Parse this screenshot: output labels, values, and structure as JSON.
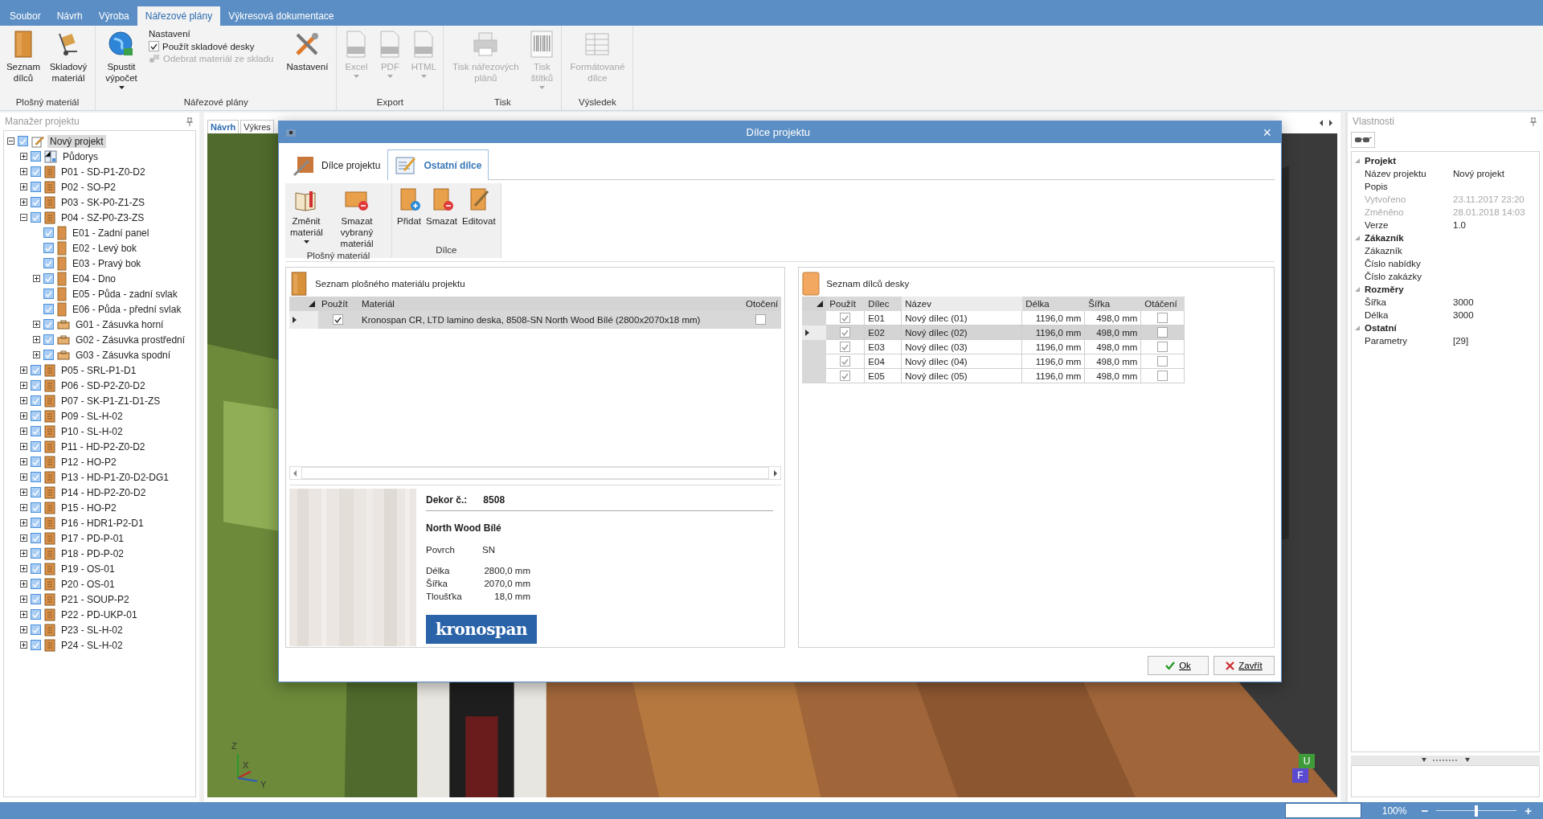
{
  "menu_tabs": [
    {
      "label": "Soubor",
      "selected": false
    },
    {
      "label": "Návrh",
      "selected": false
    },
    {
      "label": "Výroba",
      "selected": false
    },
    {
      "label": "Nářezové plány",
      "selected": true
    },
    {
      "label": "Výkresová dokumentace",
      "selected": false
    }
  ],
  "ribbon": {
    "groups": [
      {
        "label": "Plošný materiál",
        "items": [
          {
            "kind": "large",
            "label": "Seznam dílců",
            "disabled": false,
            "dropdown": false
          },
          {
            "kind": "large",
            "label": "Skladový materiál",
            "disabled": false,
            "dropdown": false
          }
        ]
      },
      {
        "label": "Nářezové plány",
        "items": [
          {
            "kind": "large",
            "label": "Spustit výpočet",
            "disabled": false,
            "dropdown": true
          },
          {
            "kind": "options",
            "title": "Nastavení",
            "checkbox": {
              "label": "Použít skladové desky",
              "checked": true
            },
            "action": {
              "label": "Odebrat materiál ze skladu",
              "disabled": true
            }
          },
          {
            "kind": "large",
            "label": "Nastavení",
            "disabled": false,
            "dropdown": false
          }
        ]
      },
      {
        "label": "Export",
        "items": [
          {
            "kind": "large",
            "label": "Excel",
            "disabled": true,
            "dropdown": true
          },
          {
            "kind": "large",
            "label": "PDF",
            "disabled": true,
            "dropdown": true
          },
          {
            "kind": "large",
            "label": "HTML",
            "disabled": true,
            "dropdown": true
          }
        ]
      },
      {
        "label": "Tisk",
        "items": [
          {
            "kind": "large",
            "label": "Tisk nářezových plánů",
            "disabled": true,
            "dropdown": false
          },
          {
            "kind": "large",
            "label": "Tisk štítků",
            "disabled": true,
            "dropdown": true
          }
        ]
      },
      {
        "label": "Výsledek",
        "items": [
          {
            "kind": "large",
            "label": "Formátované dílce",
            "disabled": true,
            "dropdown": false
          }
        ]
      }
    ]
  },
  "project_manager": {
    "title": "Manažer projektu",
    "tree": [
      {
        "label": "Nový projekt",
        "kind": "project",
        "expandable": true,
        "expanded": true,
        "checked": true,
        "selected": true,
        "children": [
          {
            "label": "Půdorys",
            "kind": "plan",
            "expandable": true,
            "expanded": false,
            "checked": true,
            "selected": false
          },
          {
            "label": "P01 - SD-P1-Z0-D2",
            "kind": "cabinet",
            "expandable": true,
            "expanded": false,
            "checked": true,
            "selected": false
          },
          {
            "label": "P02 - SO-P2",
            "kind": "cabinet",
            "expandable": true,
            "expanded": false,
            "checked": true,
            "selected": false
          },
          {
            "label": "P03 - SK-P0-Z1-ZS",
            "kind": "cabinet",
            "expandable": true,
            "expanded": false,
            "checked": true,
            "selected": false
          },
          {
            "label": "P04 - SZ-P0-Z3-ZS",
            "kind": "cabinet",
            "expandable": true,
            "expanded": true,
            "checked": true,
            "selected": false,
            "children": [
              {
                "label": "E01 - Zadní panel",
                "kind": "panel",
                "expandable": false,
                "checked": true,
                "selected": false
              },
              {
                "label": "E02 - Levý bok",
                "kind": "panel",
                "expandable": false,
                "checked": true,
                "selected": false
              },
              {
                "label": "E03 - Pravý bok",
                "kind": "panel",
                "expandable": false,
                "checked": true,
                "selected": false
              },
              {
                "label": "E04 - Dno",
                "kind": "panel",
                "expandable": true,
                "expanded": false,
                "checked": true,
                "selected": false
              },
              {
                "label": "E05 - Půda - zadní svlak",
                "kind": "panel",
                "expandable": false,
                "checked": true,
                "selected": false
              },
              {
                "label": "E06 - Půda - přední svlak",
                "kind": "panel",
                "expandable": false,
                "checked": true,
                "selected": false
              },
              {
                "label": "G01 - Zásuvka horní",
                "kind": "drawer",
                "expandable": true,
                "expanded": false,
                "checked": true,
                "selected": false
              },
              {
                "label": "G02 - Zásuvka prostřední",
                "kind": "drawer",
                "expandable": true,
                "expanded": false,
                "checked": true,
                "selected": false
              },
              {
                "label": "G03 - Zásuvka spodní",
                "kind": "drawer",
                "expandable": true,
                "expanded": false,
                "checked": true,
                "selected": false
              }
            ]
          },
          {
            "label": "P05 - SRL-P1-D1",
            "kind": "cabinet",
            "expandable": true,
            "expanded": false,
            "checked": true,
            "selected": false
          },
          {
            "label": "P06 - SD-P2-Z0-D2",
            "kind": "cabinet",
            "expandable": true,
            "expanded": false,
            "checked": true,
            "selected": false
          },
          {
            "label": "P07 - SK-P1-Z1-D1-ZS",
            "kind": "cabinet",
            "expandable": true,
            "expanded": false,
            "checked": true,
            "selected": false
          },
          {
            "label": "P09 - SL-H-02",
            "kind": "cabinet",
            "expandable": true,
            "expanded": false,
            "checked": true,
            "selected": false
          },
          {
            "label": "P10 - SL-H-02",
            "kind": "cabinet",
            "expandable": true,
            "expanded": false,
            "checked": true,
            "selected": false
          },
          {
            "label": "P11 - HD-P2-Z0-D2",
            "kind": "cabinet",
            "expandable": true,
            "expanded": false,
            "checked": true,
            "selected": false
          },
          {
            "label": "P12 - HO-P2",
            "kind": "cabinet",
            "expandable": true,
            "expanded": false,
            "checked": true,
            "selected": false
          },
          {
            "label": "P13 - HD-P1-Z0-D2-DG1",
            "kind": "cabinet",
            "expandable": true,
            "expanded": false,
            "checked": true,
            "selected": false
          },
          {
            "label": "P14 - HD-P2-Z0-D2",
            "kind": "cabinet",
            "expandable": true,
            "expanded": false,
            "checked": true,
            "selected": false
          },
          {
            "label": "P15 - HO-P2",
            "kind": "cabinet",
            "expandable": true,
            "expanded": false,
            "checked": true,
            "selected": false
          },
          {
            "label": "P16 - HDR1-P2-D1",
            "kind": "cabinet",
            "expandable": true,
            "expanded": false,
            "checked": true,
            "selected": false
          },
          {
            "label": "P17 - PD-P-01",
            "kind": "cabinet",
            "expandable": true,
            "expanded": false,
            "checked": true,
            "selected": false
          },
          {
            "label": "P18 - PD-P-02",
            "kind": "cabinet",
            "expandable": true,
            "expanded": false,
            "checked": true,
            "selected": false
          },
          {
            "label": "P19 - OS-01",
            "kind": "cabinet",
            "expandable": true,
            "expanded": false,
            "checked": true,
            "selected": false
          },
          {
            "label": "P20 - OS-01",
            "kind": "cabinet",
            "expandable": true,
            "expanded": false,
            "checked": true,
            "selected": false
          },
          {
            "label": "P21 - SOUP-P2",
            "kind": "cabinet",
            "expandable": true,
            "expanded": false,
            "checked": true,
            "selected": false
          },
          {
            "label": "P22 - PD-UKP-01",
            "kind": "cabinet",
            "expandable": true,
            "expanded": false,
            "checked": true,
            "selected": false
          },
          {
            "label": "P23 - SL-H-02",
            "kind": "cabinet",
            "expandable": true,
            "expanded": false,
            "checked": true,
            "selected": false
          },
          {
            "label": "P24 - SL-H-02",
            "kind": "cabinet",
            "expandable": true,
            "expanded": false,
            "checked": true,
            "selected": false
          }
        ]
      }
    ]
  },
  "view": {
    "tabs": [
      {
        "label": "Návrh",
        "selected": true
      },
      {
        "label": "Výkres",
        "selected": false
      }
    ],
    "axes": [
      "Z",
      "X",
      "Y"
    ],
    "cube_faces": [
      "U",
      "F"
    ]
  },
  "properties": {
    "title": "Vlastnosti",
    "categories": [
      {
        "name": "Projekt",
        "rows": [
          {
            "label": "Název projektu",
            "value": "Nový projekt",
            "disabled": false
          },
          {
            "label": "Popis",
            "disabled": false
          },
          {
            "label": "Vytvořeno",
            "value": "23.11.2017 23:20",
            "disabled": true
          },
          {
            "label": "Změněno",
            "value": "28.01.2018 14:03",
            "disabled": true
          },
          {
            "label": "Verze",
            "value": "1.0",
            "disabled": false
          }
        ]
      },
      {
        "name": "Zákazník",
        "rows": [
          {
            "label": "Zákazník",
            "disabled": false
          },
          {
            "label": "Číslo nabídky",
            "disabled": false
          },
          {
            "label": "Číslo zakázky",
            "disabled": false
          }
        ]
      },
      {
        "name": "Rozměry",
        "rows": [
          {
            "label": "Šířka",
            "value": "3000",
            "disabled": false
          },
          {
            "label": "Délka",
            "value": "3000",
            "disabled": false
          }
        ]
      },
      {
        "name": "Ostatní",
        "rows": [
          {
            "label": "Parametry",
            "value": "[29]",
            "disabled": false
          }
        ]
      }
    ]
  },
  "dialog": {
    "title": "Dílce projektu",
    "close": "×",
    "tabs": [
      {
        "label": "Dílce projektu",
        "selected": false
      },
      {
        "label": "Ostatní dílce",
        "selected": true
      }
    ],
    "ribbon": [
      {
        "label": "Plošný materiál",
        "buttons": [
          {
            "label": "Změnit materiál",
            "dropdown": true
          },
          {
            "label": "Smazat vybraný materiál",
            "dropdown": false
          }
        ]
      },
      {
        "label": "Dílce",
        "buttons": [
          {
            "label": "Přidat",
            "dropdown": false
          },
          {
            "label": "Smazat",
            "dropdown": false
          },
          {
            "label": "Editovat",
            "dropdown": false
          }
        ]
      }
    ],
    "materials": {
      "title": "Seznam plošného materiálu projektu",
      "columns": [
        "Použít",
        "Materiál",
        "Otočení"
      ],
      "rows": [
        {
          "selected": true,
          "used": true,
          "material": "Kronospan CR, LTD lamino deska, 8508-SN North Wood Bílé (2800x2070x18 mm)",
          "rotation": false
        }
      ]
    },
    "detail": {
      "decor_label": "Dekor č.:",
      "decor": "8508",
      "name": "North Wood Bílé",
      "fields": [
        {
          "label": "Povrch",
          "value": "SN"
        },
        {
          "label": "Délka",
          "value": "2800,0 mm"
        },
        {
          "label": "Šířka",
          "value": "2070,0 mm"
        },
        {
          "label": "Tloušťka",
          "value": "18,0 mm"
        }
      ],
      "brand": "kronospan"
    },
    "parts": {
      "title": "Seznam dílců desky",
      "columns": [
        "Použít",
        "Dílec",
        "Název",
        "Délka",
        "Šířka",
        "Otáčení"
      ],
      "rows": [
        {
          "selected": false,
          "used": true,
          "code": "E01",
          "name": "Nový dílec (01)",
          "length": "1196,0 mm",
          "width": "498,0 mm",
          "rotation": false
        },
        {
          "selected": true,
          "used": true,
          "code": "E02",
          "name": "Nový dílec (02)",
          "length": "1196,0 mm",
          "width": "498,0 mm",
          "rotation": false
        },
        {
          "selected": false,
          "used": true,
          "code": "E03",
          "name": "Nový dílec (03)",
          "length": "1196,0 mm",
          "width": "498,0 mm",
          "rotation": false
        },
        {
          "selected": false,
          "used": true,
          "code": "E04",
          "name": "Nový dílec (04)",
          "length": "1196,0 mm",
          "width": "498,0 mm",
          "rotation": false
        },
        {
          "selected": false,
          "used": true,
          "code": "E05",
          "name": "Nový dílec (05)",
          "length": "1196,0 mm",
          "width": "498,0 mm",
          "rotation": false
        }
      ]
    },
    "buttons": [
      {
        "label": "Ok",
        "kind": "ok"
      },
      {
        "label": "Zavřít",
        "kind": "cancel"
      }
    ]
  },
  "status_bar": {
    "zoom": "100%",
    "minus": "−",
    "plus": "+",
    "slider": {
      "level": 0.5
    }
  }
}
